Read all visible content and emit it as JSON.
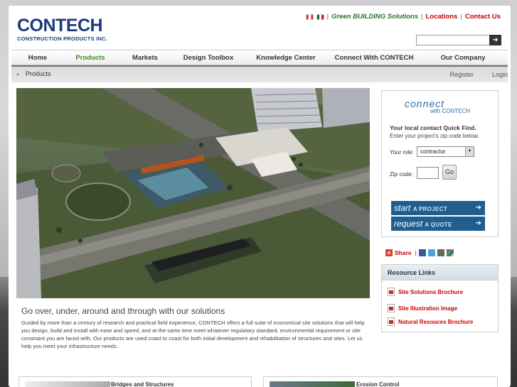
{
  "brand": {
    "name": "CONTECH",
    "tagline": "CONSTRUCTION PRODUCTS INC."
  },
  "toplinks": {
    "green_building": "Green BUILDING Solutions",
    "locations": "Locations",
    "contact": "Contact Us"
  },
  "search": {
    "placeholder": "",
    "button": "➜"
  },
  "nav": [
    "Home",
    "Products",
    "Markets",
    "Design Toolbox",
    "Knowledge Center",
    "Connect With CONTECH",
    "Our Company"
  ],
  "nav_active": "Products",
  "subnav": {
    "crumb": "Products",
    "register": "Register",
    "login": "Login"
  },
  "hero": {
    "headline": "Go over, under, around and through with our solutions",
    "body": "Guided by more than a century of research and practical field experience, CONTECH offers a full suite of economical site solutions that will help you design, build and install with ease and speed, and at the same time meet whatever regulatory standard, environmental requirement or site constraint you are faced with. Our products are used coast to coast for both initial development and rehabilitation of structures and sites. Let us help you meet your infrastructure needs."
  },
  "connect": {
    "logo_top": "connect",
    "logo_bottom": "with CONTECH",
    "quick": "Your local contact Quick Find.",
    "enter": "Enter your project's zip code below.",
    "role_label": "Your role:",
    "role_value": "contractor",
    "zip_label": "Zip code:",
    "go": "Go",
    "start_script": "start",
    "start_caps": "A PROJECT",
    "request_script": "request",
    "request_caps": "A QUOTE"
  },
  "share": {
    "label": "Share",
    "sep": "|"
  },
  "resources": {
    "heading": "Resource Links",
    "items": [
      "Site Solutions Brochure",
      "Site Illustration Image",
      "Natural Resouces Brochure"
    ]
  },
  "cards": [
    "Bridges and Structures",
    "Erosion Control"
  ],
  "colors": {
    "brand_blue": "#1d3a78",
    "active_green": "#3f8a26",
    "link_red": "#c00000",
    "button_blue": "#1f5e8f"
  }
}
